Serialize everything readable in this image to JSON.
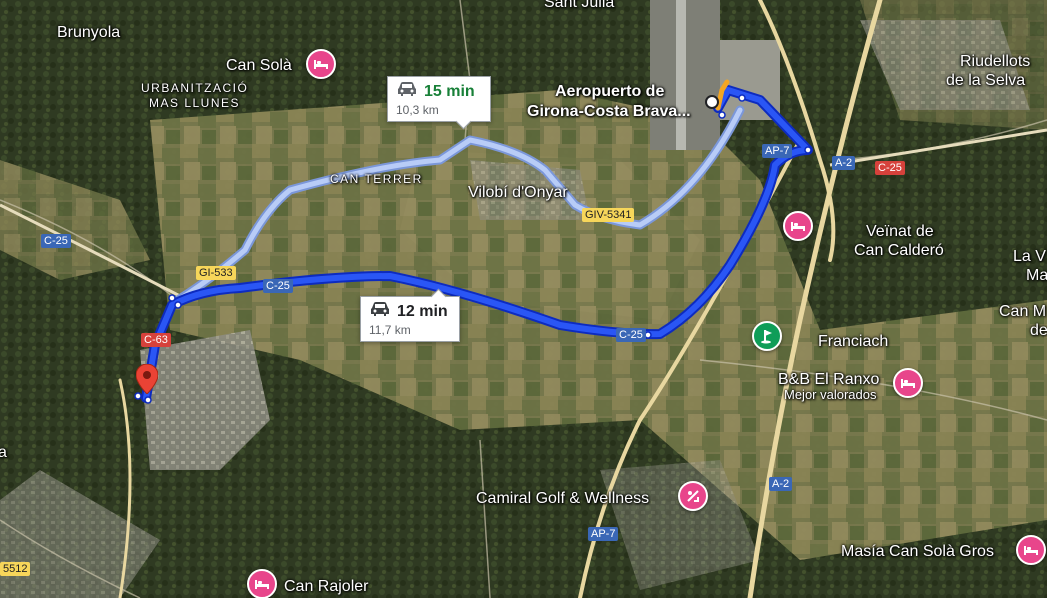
{
  "map": {
    "place_labels": {
      "brunyola": "Brunyola",
      "can_sola": "Can Solà",
      "urbanitzacio": "URBANITZACIÓ",
      "mas_llunes": "MAS LLUNES",
      "sant_julia": "Sant Julià",
      "aeropuerto_line1": "Aeropuerto de",
      "aeropuerto_line2": "Girona-Costa Brava...",
      "riudellots_line1": "Riudellots",
      "riudellots_line2": "de la Selva",
      "can_terrer": "CAN TERRER",
      "vilobi": "Vilobí d'Onyar",
      "veinat_line1": "Veïnat de",
      "veinat_line2": "Can Calderó",
      "la_v": "La V",
      "ma": "Ma",
      "can_m": "Can M",
      "de": "de",
      "franciach": "Franciach",
      "bb_ranxo": "B&B El Ranxo",
      "mejor_valorados": "Mejor valorados",
      "camiral": "Camiral Golf & Wellness",
      "masia": "Masía Can Solà Gros",
      "can_rajoler": "Can Rajoler",
      "left_a": "a"
    },
    "road_shields": {
      "c25_left": "C-25",
      "c25_mid": "C-25",
      "c25_right": "C-25",
      "c25_far": "C-25",
      "gi533": "GI-533",
      "giv5341": "GIV-5341",
      "c63": "C-63",
      "ap7_top": "AP-7",
      "a2_top": "A-2",
      "a2_bottom": "A-2",
      "ap7_bottom": "AP-7",
      "left_5512": "5512"
    },
    "routes": {
      "alternative": {
        "time": "15 min",
        "distance": "10,3 km",
        "color": "#a8c7fa"
      },
      "primary": {
        "time": "12 min",
        "distance": "11,7 km",
        "color": "#1a3fe0"
      }
    },
    "pois": {
      "hotel_icon": "bed-icon",
      "golf_icon": "golf-icon",
      "wellness_icon": "spa-icon",
      "pin_icon": "location-pin-icon",
      "car_icon": "car-icon",
      "pin_color": "#ea4335"
    }
  }
}
